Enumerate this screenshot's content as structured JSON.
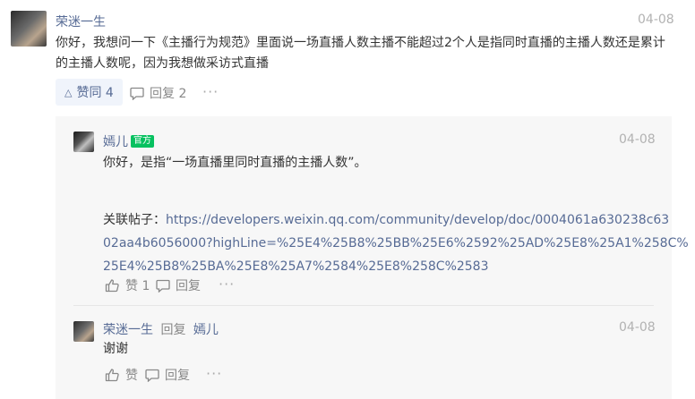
{
  "comment": {
    "author": "荣迷一生",
    "date": "04-08",
    "text_line1": "你好，我想问一下《主播行为规范》里面说一场直播人数主播不能超过2个人是指同时直播的主播人数还是累计",
    "text_line2": "的主播人数呢，因为我想做采访式直播",
    "like_label": "赞同 4",
    "reply_label": "回复 2",
    "more": "···"
  },
  "replies": [
    {
      "author": "嫣儿",
      "badge": "官方",
      "date": "04-08",
      "text": "你好，是指“一场直播里同时直播的主播人数”。",
      "link_prefix": "关联帖子：",
      "link_line1": "https://developers.weixin.qq.com/community/develop/doc/0004061a630238c63",
      "link_line2": "02aa4b6056000?highLine=%25E4%25B8%25BB%25E6%2592%25AD%25E8%25A1%258C%",
      "link_line3": "25E4%25B8%25BA%25E8%25A7%2584%25E8%258C%2583",
      "like_label": "赞 1",
      "reply_label": "回复",
      "more": "···"
    },
    {
      "author": "荣迷一生",
      "reply_word": "回复",
      "reply_to": "嫣儿",
      "date": "04-08",
      "text": "谢谢",
      "like_label": "赞",
      "reply_label": "回复",
      "more": "···"
    }
  ]
}
